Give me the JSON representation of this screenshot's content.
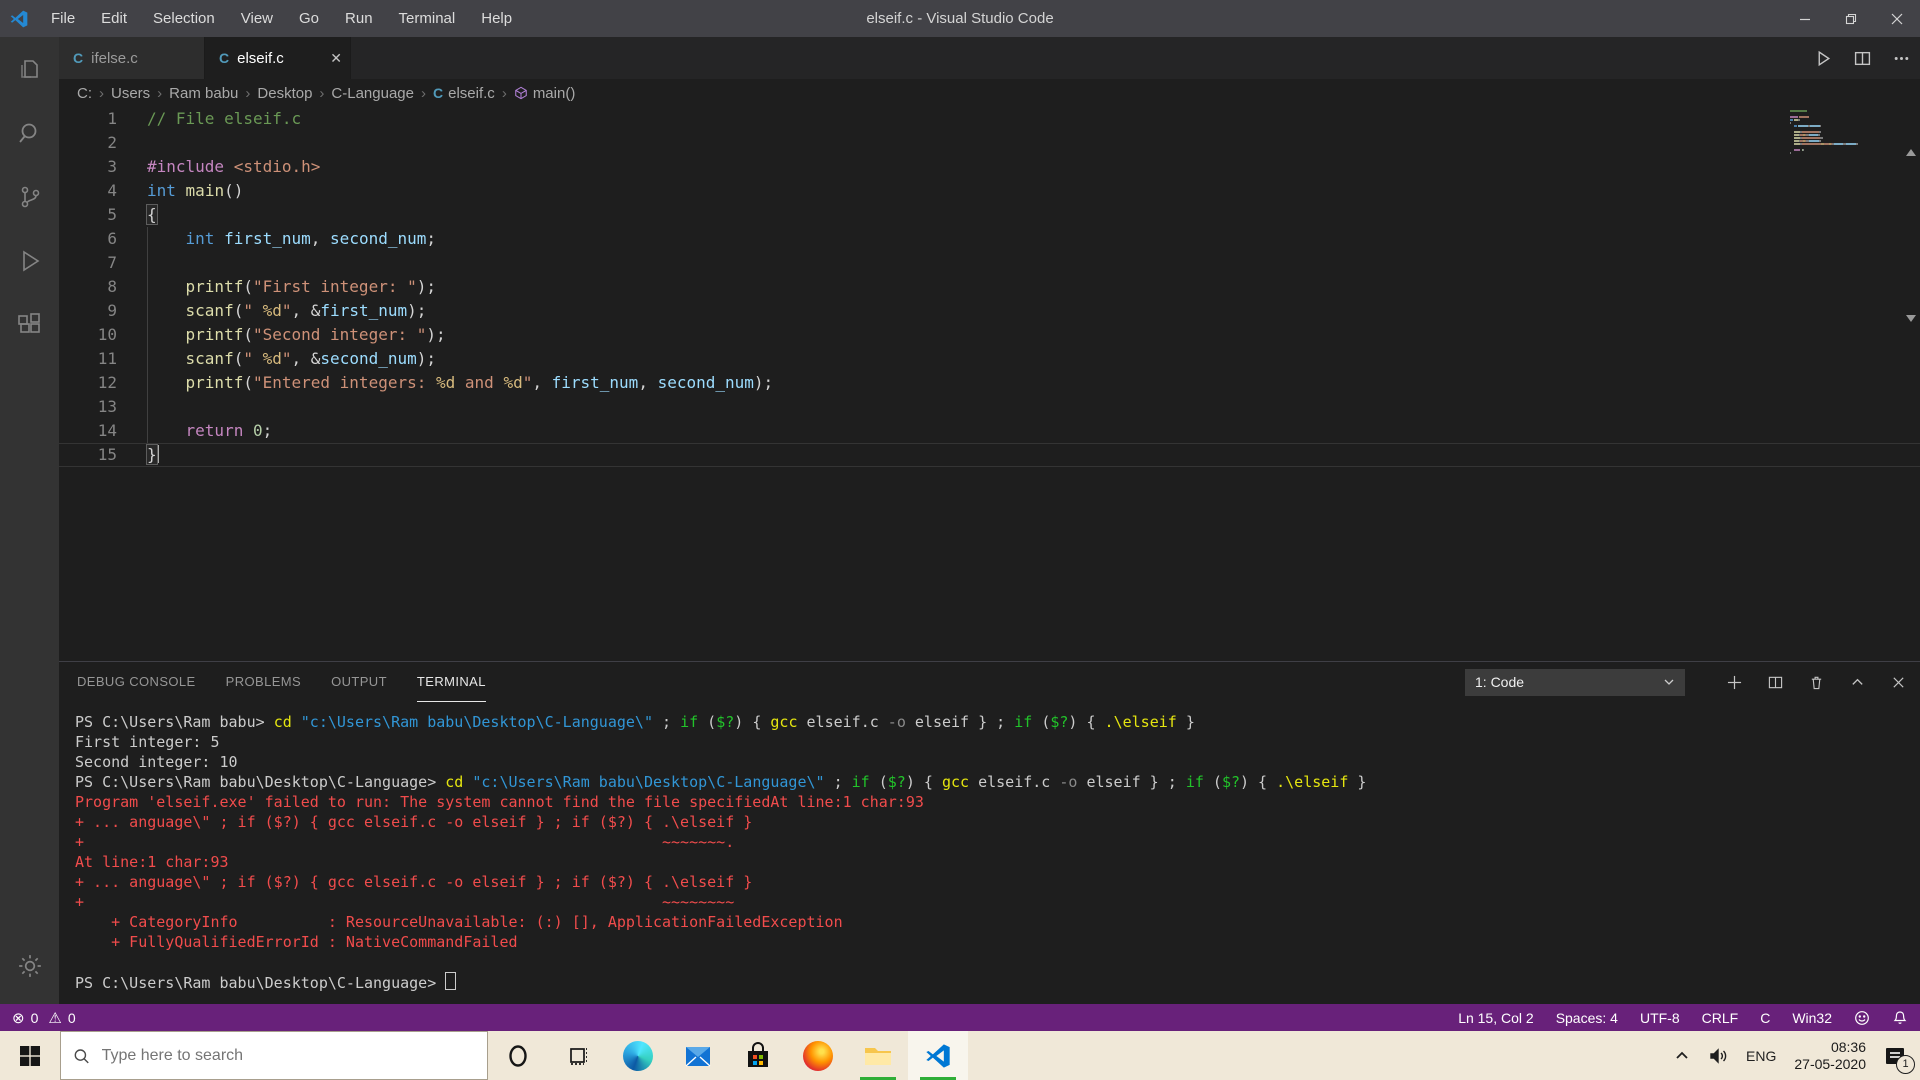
{
  "colors": {
    "statusbar": "#68217A",
    "editor_bg": "#1e1e1e",
    "activitybar_bg": "#333333",
    "taskbar_bg": "#f0e8d8",
    "running_indicator": "#2fae37",
    "error_red": "#f14c4c",
    "file_icon_blue": "#519aba",
    "symbol_purple": "#B180D7",
    "vscode_blue": "#007ACC"
  },
  "window": {
    "title": "elseif.c - Visual Studio Code",
    "menus": [
      "File",
      "Edit",
      "Selection",
      "View",
      "Go",
      "Run",
      "Terminal",
      "Help"
    ]
  },
  "tabs": [
    {
      "label": "ifelse.c",
      "active": false,
      "icon": "c-file-icon"
    },
    {
      "label": "elseif.c",
      "active": true,
      "icon": "c-file-icon",
      "close": "✕"
    }
  ],
  "breadcrumb": {
    "path": [
      "C:",
      "Users",
      "Ram babu",
      "Desktop",
      "C-Language"
    ],
    "file": "elseif.c",
    "symbol": "main()"
  },
  "editor": {
    "cursor_line": 15,
    "lines": [
      {
        "num": 1,
        "segments": [
          {
            "c": "comment",
            "t": "// File elseif.c"
          }
        ]
      },
      {
        "num": 2,
        "segments": []
      },
      {
        "num": 3,
        "segments": [
          {
            "c": "pre",
            "t": "#include"
          },
          {
            "c": "plain",
            "t": " "
          },
          {
            "c": "str",
            "t": "<stdio.h>"
          }
        ]
      },
      {
        "num": 4,
        "segments": [
          {
            "c": "kw",
            "t": "int"
          },
          {
            "c": "plain",
            "t": " "
          },
          {
            "c": "func",
            "t": "main"
          },
          {
            "c": "plain",
            "t": "()"
          }
        ]
      },
      {
        "num": 5,
        "segments": [
          {
            "c": "bracket",
            "t": "{"
          }
        ]
      },
      {
        "num": 6,
        "segments": [
          {
            "c": "plain",
            "t": "    "
          },
          {
            "c": "kw",
            "t": "int"
          },
          {
            "c": "plain",
            "t": " "
          },
          {
            "c": "var",
            "t": "first_num"
          },
          {
            "c": "plain",
            "t": ", "
          },
          {
            "c": "var",
            "t": "second_num"
          },
          {
            "c": "plain",
            "t": ";"
          }
        ]
      },
      {
        "num": 7,
        "segments": []
      },
      {
        "num": 8,
        "segments": [
          {
            "c": "plain",
            "t": "    "
          },
          {
            "c": "func",
            "t": "printf"
          },
          {
            "c": "plain",
            "t": "("
          },
          {
            "c": "str",
            "t": "\"First integer: \""
          },
          {
            "c": "plain",
            "t": ");"
          }
        ]
      },
      {
        "num": 9,
        "segments": [
          {
            "c": "plain",
            "t": "    "
          },
          {
            "c": "func",
            "t": "scanf"
          },
          {
            "c": "plain",
            "t": "("
          },
          {
            "c": "str",
            "t": "\" "
          },
          {
            "c": "fmt",
            "t": "%d"
          },
          {
            "c": "str",
            "t": "\""
          },
          {
            "c": "plain",
            "t": ", &"
          },
          {
            "c": "var",
            "t": "first_num"
          },
          {
            "c": "plain",
            "t": ");"
          }
        ]
      },
      {
        "num": 10,
        "segments": [
          {
            "c": "plain",
            "t": "    "
          },
          {
            "c": "func",
            "t": "printf"
          },
          {
            "c": "plain",
            "t": "("
          },
          {
            "c": "str",
            "t": "\"Second integer: \""
          },
          {
            "c": "plain",
            "t": ");"
          }
        ]
      },
      {
        "num": 11,
        "segments": [
          {
            "c": "plain",
            "t": "    "
          },
          {
            "c": "func",
            "t": "scanf"
          },
          {
            "c": "plain",
            "t": "("
          },
          {
            "c": "str",
            "t": "\" "
          },
          {
            "c": "fmt",
            "t": "%d"
          },
          {
            "c": "str",
            "t": "\""
          },
          {
            "c": "plain",
            "t": ", &"
          },
          {
            "c": "var",
            "t": "second_num"
          },
          {
            "c": "plain",
            "t": ");"
          }
        ]
      },
      {
        "num": 12,
        "segments": [
          {
            "c": "plain",
            "t": "    "
          },
          {
            "c": "func",
            "t": "printf"
          },
          {
            "c": "plain",
            "t": "("
          },
          {
            "c": "str",
            "t": "\"Entered integers: "
          },
          {
            "c": "fmt",
            "t": "%d"
          },
          {
            "c": "str",
            "t": " and "
          },
          {
            "c": "fmt",
            "t": "%d"
          },
          {
            "c": "str",
            "t": "\""
          },
          {
            "c": "plain",
            "t": ", "
          },
          {
            "c": "var",
            "t": "first_num"
          },
          {
            "c": "plain",
            "t": ", "
          },
          {
            "c": "var",
            "t": "second_num"
          },
          {
            "c": "plain",
            "t": ");"
          }
        ]
      },
      {
        "num": 13,
        "segments": []
      },
      {
        "num": 14,
        "segments": [
          {
            "c": "plain",
            "t": "    "
          },
          {
            "c": "ctrl",
            "t": "return"
          },
          {
            "c": "plain",
            "t": " "
          },
          {
            "c": "num",
            "t": "0"
          },
          {
            "c": "plain",
            "t": ";"
          }
        ]
      },
      {
        "num": 15,
        "segments": [
          {
            "c": "bracket",
            "t": "}"
          },
          {
            "c": "cursor",
            "t": ""
          }
        ]
      }
    ]
  },
  "panel": {
    "tabs": [
      {
        "label": "DEBUG CONSOLE",
        "active": false
      },
      {
        "label": "PROBLEMS",
        "active": false
      },
      {
        "label": "OUTPUT",
        "active": false
      },
      {
        "label": "TERMINAL",
        "active": true
      }
    ],
    "dropdown_value": "1: Code"
  },
  "terminal": {
    "lines": [
      [
        {
          "c": "plain",
          "t": "PS C:\\Users\\Ram babu> "
        },
        {
          "c": "cmd",
          "t": "cd"
        },
        {
          "c": "plain",
          "t": " "
        },
        {
          "c": "path",
          "t": "\"c:\\Users\\Ram babu\\Desktop\\C-Language\\\""
        },
        {
          "c": "plain",
          "t": " ; "
        },
        {
          "c": "kw",
          "t": "if"
        },
        {
          "c": "plain",
          "t": " ("
        },
        {
          "c": "kw",
          "t": "$?"
        },
        {
          "c": "plain",
          "t": ") { "
        },
        {
          "c": "cmd",
          "t": "gcc"
        },
        {
          "c": "plain",
          "t": " elseif.c "
        },
        {
          "c": "dim",
          "t": "-o"
        },
        {
          "c": "plain",
          "t": " elseif } ; "
        },
        {
          "c": "kw",
          "t": "if"
        },
        {
          "c": "plain",
          "t": " ("
        },
        {
          "c": "kw",
          "t": "$?"
        },
        {
          "c": "plain",
          "t": ") { "
        },
        {
          "c": "cmd",
          "t": ".\\elseif"
        },
        {
          "c": "plain",
          "t": " }"
        }
      ],
      [
        {
          "c": "plain",
          "t": "First integer: 5"
        }
      ],
      [
        {
          "c": "plain",
          "t": "Second integer: 10"
        }
      ],
      [
        {
          "c": "plain",
          "t": "PS C:\\Users\\Ram babu\\Desktop\\C-Language> "
        },
        {
          "c": "cmd",
          "t": "cd"
        },
        {
          "c": "plain",
          "t": " "
        },
        {
          "c": "path",
          "t": "\"c:\\Users\\Ram babu\\Desktop\\C-Language\\\""
        },
        {
          "c": "plain",
          "t": " ; "
        },
        {
          "c": "kw",
          "t": "if"
        },
        {
          "c": "plain",
          "t": " ("
        },
        {
          "c": "kw",
          "t": "$?"
        },
        {
          "c": "plain",
          "t": ") { "
        },
        {
          "c": "cmd",
          "t": "gcc"
        },
        {
          "c": "plain",
          "t": " elseif.c "
        },
        {
          "c": "dim",
          "t": "-o"
        },
        {
          "c": "plain",
          "t": " elseif } ; "
        },
        {
          "c": "kw",
          "t": "if"
        },
        {
          "c": "plain",
          "t": " ("
        },
        {
          "c": "kw",
          "t": "$?"
        },
        {
          "c": "plain",
          "t": ") { "
        },
        {
          "c": "cmd",
          "t": ".\\elseif"
        },
        {
          "c": "plain",
          "t": " }"
        }
      ],
      [
        {
          "c": "err",
          "t": "Program 'elseif.exe' failed to run: The system cannot find the file specifiedAt line:1 char:93"
        }
      ],
      [
        {
          "c": "err",
          "t": "+ ... anguage\\\" ; if ($?) { gcc elseif.c -o elseif } ; if ($?) { .\\elseif }"
        }
      ],
      [
        {
          "c": "err",
          "t": "+"
        },
        {
          "c": "err",
          "sp": 64
        },
        {
          "c": "err",
          "t": "~~~~~~~."
        }
      ],
      [
        {
          "c": "err",
          "t": "At line:1 char:93"
        }
      ],
      [
        {
          "c": "err",
          "t": "+ ... anguage\\\" ; if ($?) { gcc elseif.c -o elseif } ; if ($?) { .\\elseif }"
        }
      ],
      [
        {
          "c": "err",
          "t": "+"
        },
        {
          "c": "err",
          "sp": 64
        },
        {
          "c": "err",
          "t": "~~~~~~~~"
        }
      ],
      [
        {
          "c": "err",
          "t": "    + CategoryInfo          : ResourceUnavailable: (:) [], ApplicationFailedException"
        }
      ],
      [
        {
          "c": "err",
          "t": "    + FullyQualifiedErrorId : NativeCommandFailed"
        }
      ],
      [],
      [
        {
          "c": "plain",
          "t": "PS C:\\Users\\Ram babu\\Desktop\\C-Language> "
        },
        {
          "c": "cursor",
          "t": ""
        }
      ]
    ]
  },
  "statusbar": {
    "errors": "0",
    "warnings": "0",
    "items": [
      "Ln 15, Col 2",
      "Spaces: 4",
      "UTF-8",
      "CRLF",
      "C",
      "Win32"
    ]
  },
  "taskbar": {
    "search_placeholder": "Type here to search",
    "language": "ENG",
    "time": "08:36",
    "date": "27-05-2020",
    "notification_count": "1"
  }
}
